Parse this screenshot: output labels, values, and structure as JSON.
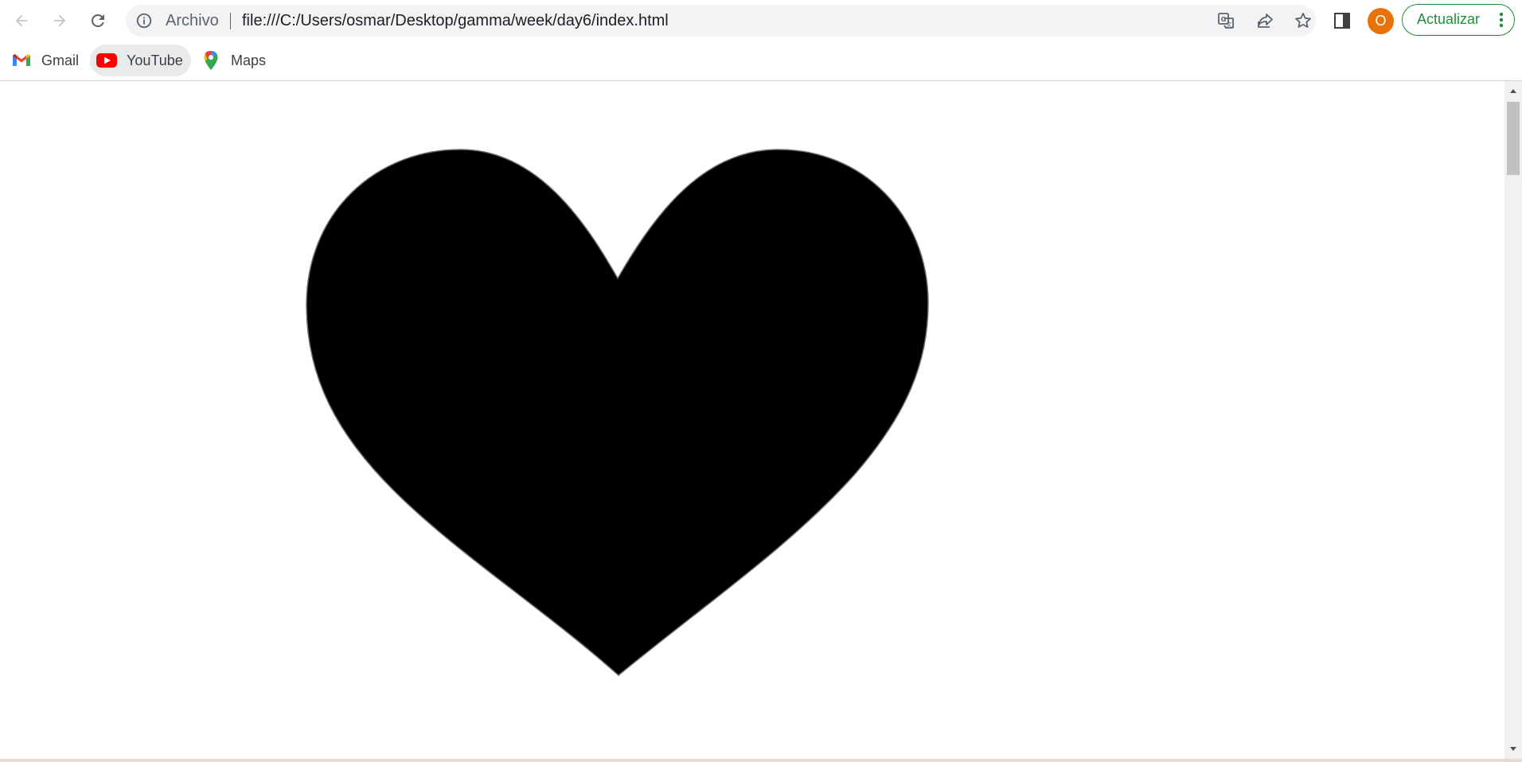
{
  "browser": {
    "nav": {
      "back_icon": "arrow-left-icon",
      "forward_icon": "arrow-right-icon",
      "reload_icon": "reload-icon"
    },
    "omnibox": {
      "scheme_label": "Archivo",
      "url": "file:///C:/Users/osmar/Desktop/gamma/week/day6/index.html",
      "icons": [
        "info-icon",
        "translate-icon",
        "share-icon",
        "star-icon"
      ]
    },
    "toolbar": {
      "side_panel_icon": "side-panel-icon",
      "avatar_letter": "O",
      "avatar_color": "#e8710a",
      "update_label": "Actualizar",
      "update_color": "#1e8e3e"
    },
    "bookmarks": [
      {
        "label": "Gmail",
        "icon": "gmail-icon"
      },
      {
        "label": "YouTube",
        "icon": "youtube-icon"
      },
      {
        "label": "Maps",
        "icon": "maps-icon"
      }
    ]
  },
  "page": {
    "content_shape": "heart",
    "shape_color": "#000000",
    "background": "#ffffff"
  }
}
